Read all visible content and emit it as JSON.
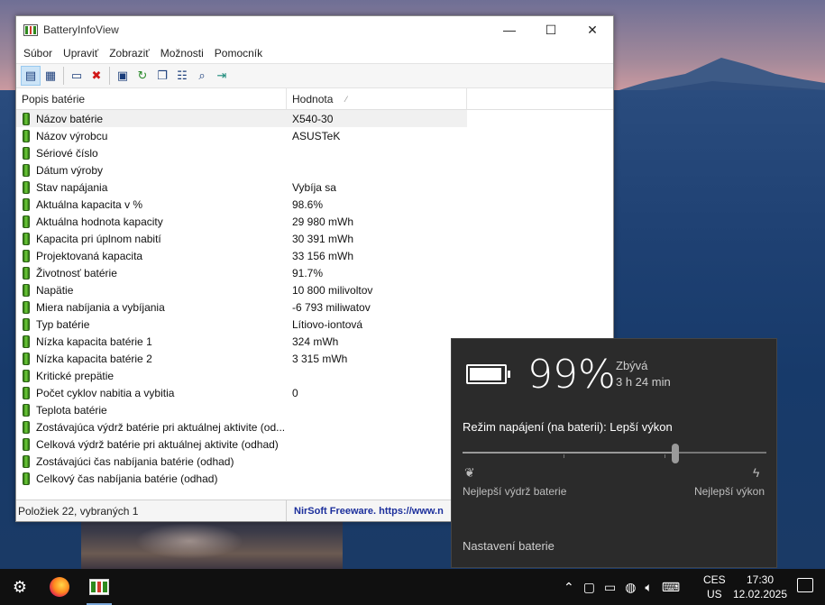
{
  "window": {
    "title": "BatteryInfoView",
    "controls": {
      "minimize": "—",
      "maximize": "☐",
      "close": "✕"
    },
    "menu": [
      "Súbor",
      "Upraviť",
      "Zobraziť",
      "Možnosti",
      "Pomocník"
    ],
    "columns": {
      "name": "Popis batérie",
      "value": "Hodnota"
    },
    "rows": [
      {
        "name": "Názov batérie",
        "value": "X540-30"
      },
      {
        "name": "Názov výrobcu",
        "value": "ASUSTeK"
      },
      {
        "name": "Sériové číslo",
        "value": ""
      },
      {
        "name": "Dátum výroby",
        "value": ""
      },
      {
        "name": "Stav napájania",
        "value": "Vybíja sa"
      },
      {
        "name": "Aktuálna kapacita v %",
        "value": "98.6%"
      },
      {
        "name": "Aktuálna hodnota kapacity",
        "value": "29 980 mWh"
      },
      {
        "name": "Kapacita pri úplnom nabití",
        "value": "30 391 mWh"
      },
      {
        "name": "Projektovaná kapacita",
        "value": "33 156 mWh"
      },
      {
        "name": "Životnosť batérie",
        "value": "91.7%"
      },
      {
        "name": "Napätie",
        "value": "10 800 milivoltov"
      },
      {
        "name": "Miera nabíjania a vybíjania",
        "value": "-6 793 miliwatov"
      },
      {
        "name": "Typ batérie",
        "value": "Lítiovo-iontová"
      },
      {
        "name": "Nízka kapacita batérie 1",
        "value": "324 mWh"
      },
      {
        "name": "Nízka kapacita batérie 2",
        "value": "3 315 mWh"
      },
      {
        "name": "Kritické prepätie",
        "value": ""
      },
      {
        "name": "Počet cyklov nabitia a vybitia",
        "value": "0"
      },
      {
        "name": "Teplota batérie",
        "value": ""
      },
      {
        "name": "Zostávajúca výdrž batérie pri aktuálnej aktivite (od...",
        "value": ""
      },
      {
        "name": "Celková výdrž batérie pri aktuálnej aktivite (odhad)",
        "value": ""
      },
      {
        "name": "Zostávajúci čas nabíjania batérie (odhad)",
        "value": ""
      },
      {
        "name": "Celkový čas nabíjania batérie (odhad)",
        "value": ""
      }
    ],
    "status_left": "Položiek 22, vybraných 1",
    "status_right": "NirSoft Freeware. https://www.n"
  },
  "battery_flyout": {
    "percent": "99%",
    "remaining_label": "Zbývá",
    "remaining_value": "3 h 24 min",
    "power_mode": "Režim napájení (na baterii): Lepší výkon",
    "slider_level": 0.7,
    "left_label": "Nejlepší výdrž baterie",
    "right_label": "Nejlepší výkon",
    "settings_link": "Nastavení baterie"
  },
  "taskbar": {
    "lang_top": "CES",
    "lang_bottom": "US",
    "time": "17:30",
    "date": "12.02.2025"
  }
}
